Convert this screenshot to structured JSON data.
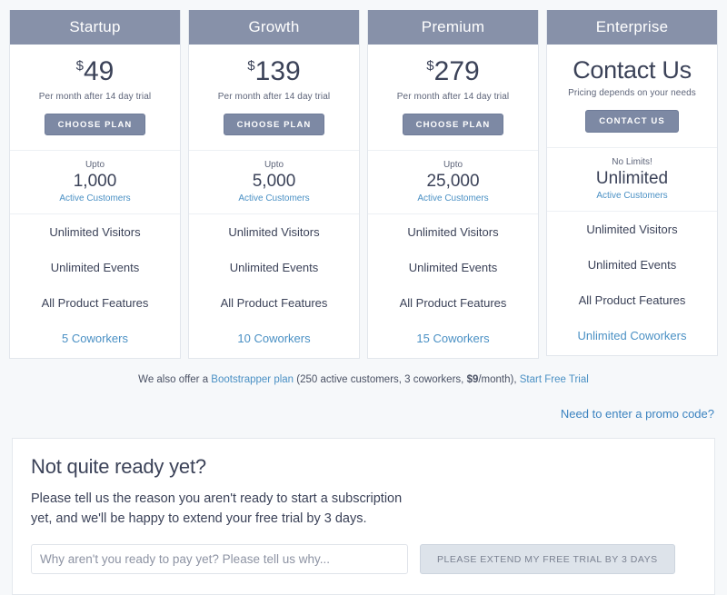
{
  "plans": [
    {
      "name": "Startup",
      "currency": "$",
      "price": "49",
      "price_note": "Per month after 14 day trial",
      "cta_label": "CHOOSE PLAN",
      "quota_prefix": "Upto",
      "quota_value": "1,000",
      "quota_label": "Active Customers",
      "features": [
        "Unlimited Visitors",
        "Unlimited Events",
        "All Product Features"
      ],
      "coworkers": "5 Coworkers"
    },
    {
      "name": "Growth",
      "currency": "$",
      "price": "139",
      "price_note": "Per month after 14 day trial",
      "cta_label": "CHOOSE PLAN",
      "quota_prefix": "Upto",
      "quota_value": "5,000",
      "quota_label": "Active Customers",
      "features": [
        "Unlimited Visitors",
        "Unlimited Events",
        "All Product Features"
      ],
      "coworkers": "10 Coworkers"
    },
    {
      "name": "Premium",
      "currency": "$",
      "price": "279",
      "price_note": "Per month after 14 day trial",
      "cta_label": "CHOOSE PLAN",
      "quota_prefix": "Upto",
      "quota_value": "25,000",
      "quota_label": "Active Customers",
      "features": [
        "Unlimited Visitors",
        "Unlimited Events",
        "All Product Features"
      ],
      "coworkers": "15 Coworkers"
    },
    {
      "name": "Enterprise",
      "currency": "",
      "price": "Contact Us",
      "price_note": "Pricing depends on your needs",
      "cta_label": "CONTACT US",
      "quota_prefix": "No Limits!",
      "quota_value": "Unlimited",
      "quota_label": "Active Customers",
      "features": [
        "Unlimited Visitors",
        "Unlimited Events",
        "All Product Features"
      ],
      "coworkers": "Unlimited Coworkers"
    }
  ],
  "offer_line": {
    "lead": "We also offer a ",
    "plan_link": "Bootstrapper plan",
    "detail_open": " (250 active customers, 3 coworkers, ",
    "price": "$9",
    "detail_close": "/month), ",
    "trial_link": "Start Free Trial"
  },
  "promo": {
    "link_label": "Need to enter a promo code?"
  },
  "panel": {
    "title": "Not quite ready yet?",
    "body": "Please tell us the reason you aren't ready to start a subscription yet, and we'll be happy to extend your free trial by 3 days.",
    "input_placeholder": "Why aren't you ready to pay yet? Please tell us why...",
    "input_value": "",
    "submit_label": "PLEASE EXTEND MY FREE TRIAL BY 3 DAYS"
  },
  "colors": {
    "header_slate": "#8791a9",
    "button_slate": "#7d89a4",
    "link_blue": "#4a90c4",
    "page_bg": "#f6f8fa",
    "text_dark": "#3b4258"
  }
}
